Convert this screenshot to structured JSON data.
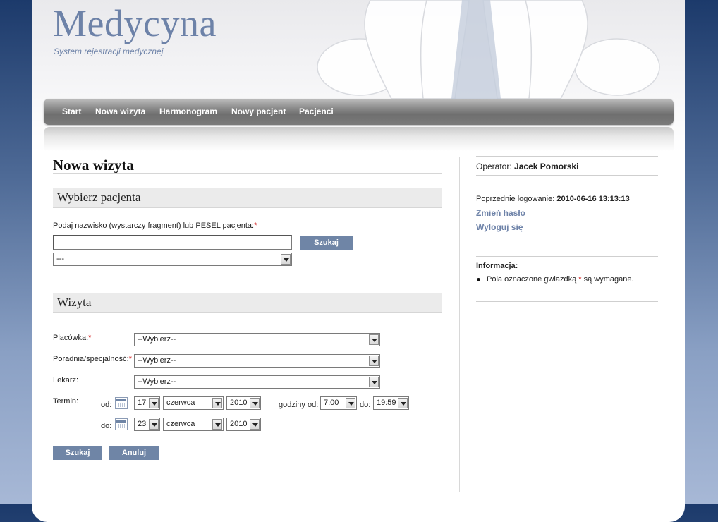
{
  "header": {
    "title": "Medycyna",
    "subtitle": "System rejestracji medycznej"
  },
  "nav": {
    "items": [
      {
        "label": "Start"
      },
      {
        "label": "Nowa wizyta"
      },
      {
        "label": "Harmonogram"
      },
      {
        "label": "Nowy pacjent"
      },
      {
        "label": "Pacjenci"
      }
    ]
  },
  "main": {
    "page_title": "Nowa wizyta",
    "patient_section": {
      "heading": "Wybierz pacjenta",
      "search_label": "Podaj nazwisko (wystarczy fragment) lub PESEL pacjenta:",
      "required_mark": "*",
      "search_value": "",
      "search_button": "Szukaj",
      "patient_select": "---"
    },
    "visit_section": {
      "heading": "Wizyta",
      "placowka_label": "Placówka:",
      "placowka_value": "--Wybierz--",
      "poradnia_label": "Poradnia/specjalność:",
      "poradnia_value": "--Wybierz--",
      "lekarz_label": "Lekarz:",
      "lekarz_value": "--Wybierz--",
      "termin_label": "Termin:",
      "od_label": "od:",
      "do_label": "do:",
      "from_day": "17",
      "from_month": "czerwca",
      "from_year": "2010",
      "to_day": "23",
      "to_month": "czerwca",
      "to_year": "2010",
      "hours_from_label": "godziny od:",
      "hours_from": "7:00",
      "hours_to_label": "do:",
      "hours_to": "19:59",
      "search_button": "Szukaj",
      "cancel_button": "Anuluj"
    }
  },
  "sidebar": {
    "operator_label": "Operator:",
    "operator_name": "Jacek Pomorski",
    "last_login_label": "Poprzednie logowanie:",
    "last_login_value": "2010-06-16 13:13:13",
    "change_password": "Zmień hasło",
    "logout": "Wyloguj się",
    "info_heading": "Informacja:",
    "info_text_before": "Pola oznaczone gwiazdką",
    "info_star": "*",
    "info_text_after": "są wymagane."
  },
  "colors": {
    "accent": "#6f85a6",
    "logo": "#6d82a8",
    "required": "#cc0000"
  }
}
